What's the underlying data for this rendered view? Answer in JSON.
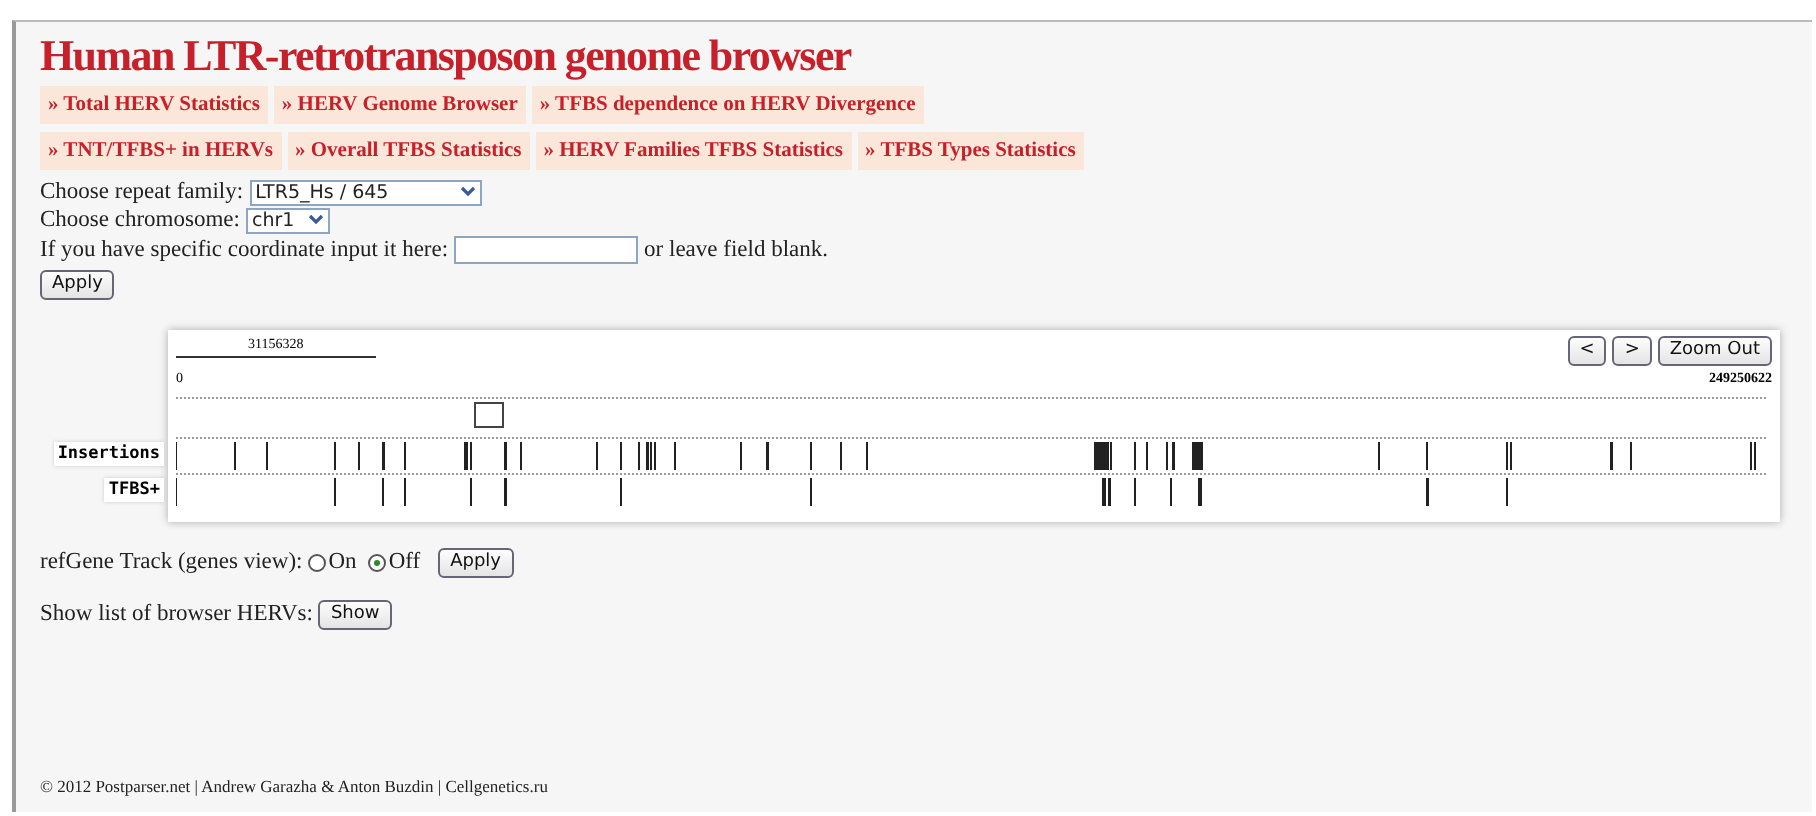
{
  "title": "Human LTR-retrotransposon genome browser",
  "nav_rows": [
    [
      "» Total HERV Statistics",
      "» HERV Genome Browser",
      "» TFBS dependence on HERV Divergence"
    ],
    [
      "» TNT/TFBS+ in HERVs",
      "» Overall TFBS Statistics",
      "» HERV Families TFBS Statistics",
      "» TFBS Types Statistics"
    ]
  ],
  "form": {
    "family_label": "Choose repeat family:",
    "family_value": "LTR5_Hs / 645",
    "chromosome_label": "Choose chromosome:",
    "chromosome_value": "chr1",
    "coordinate_label": "If you have specific coordinate input it here:",
    "coordinate_suffix": "or leave field blank.",
    "apply": "Apply"
  },
  "browser": {
    "scale_label": "31156328",
    "start": "0",
    "end": "249250622",
    "buttons": [
      "<",
      ">",
      "Zoom Out"
    ],
    "tracks": [
      {
        "label": "Insertions"
      },
      {
        "label": "TFBS+"
      }
    ]
  },
  "refgene": {
    "label": "refGene Track (genes view):",
    "options": [
      {
        "label": "On",
        "selected": false
      },
      {
        "label": "Off",
        "selected": true
      }
    ],
    "apply": "Apply"
  },
  "herv_list": {
    "label": "Show list of browser HERVs:",
    "button": "Show"
  },
  "footer": "© 2012 Postparser.net | Andrew Garazha & Anton Buzdin | Cellgenetics.ru"
}
